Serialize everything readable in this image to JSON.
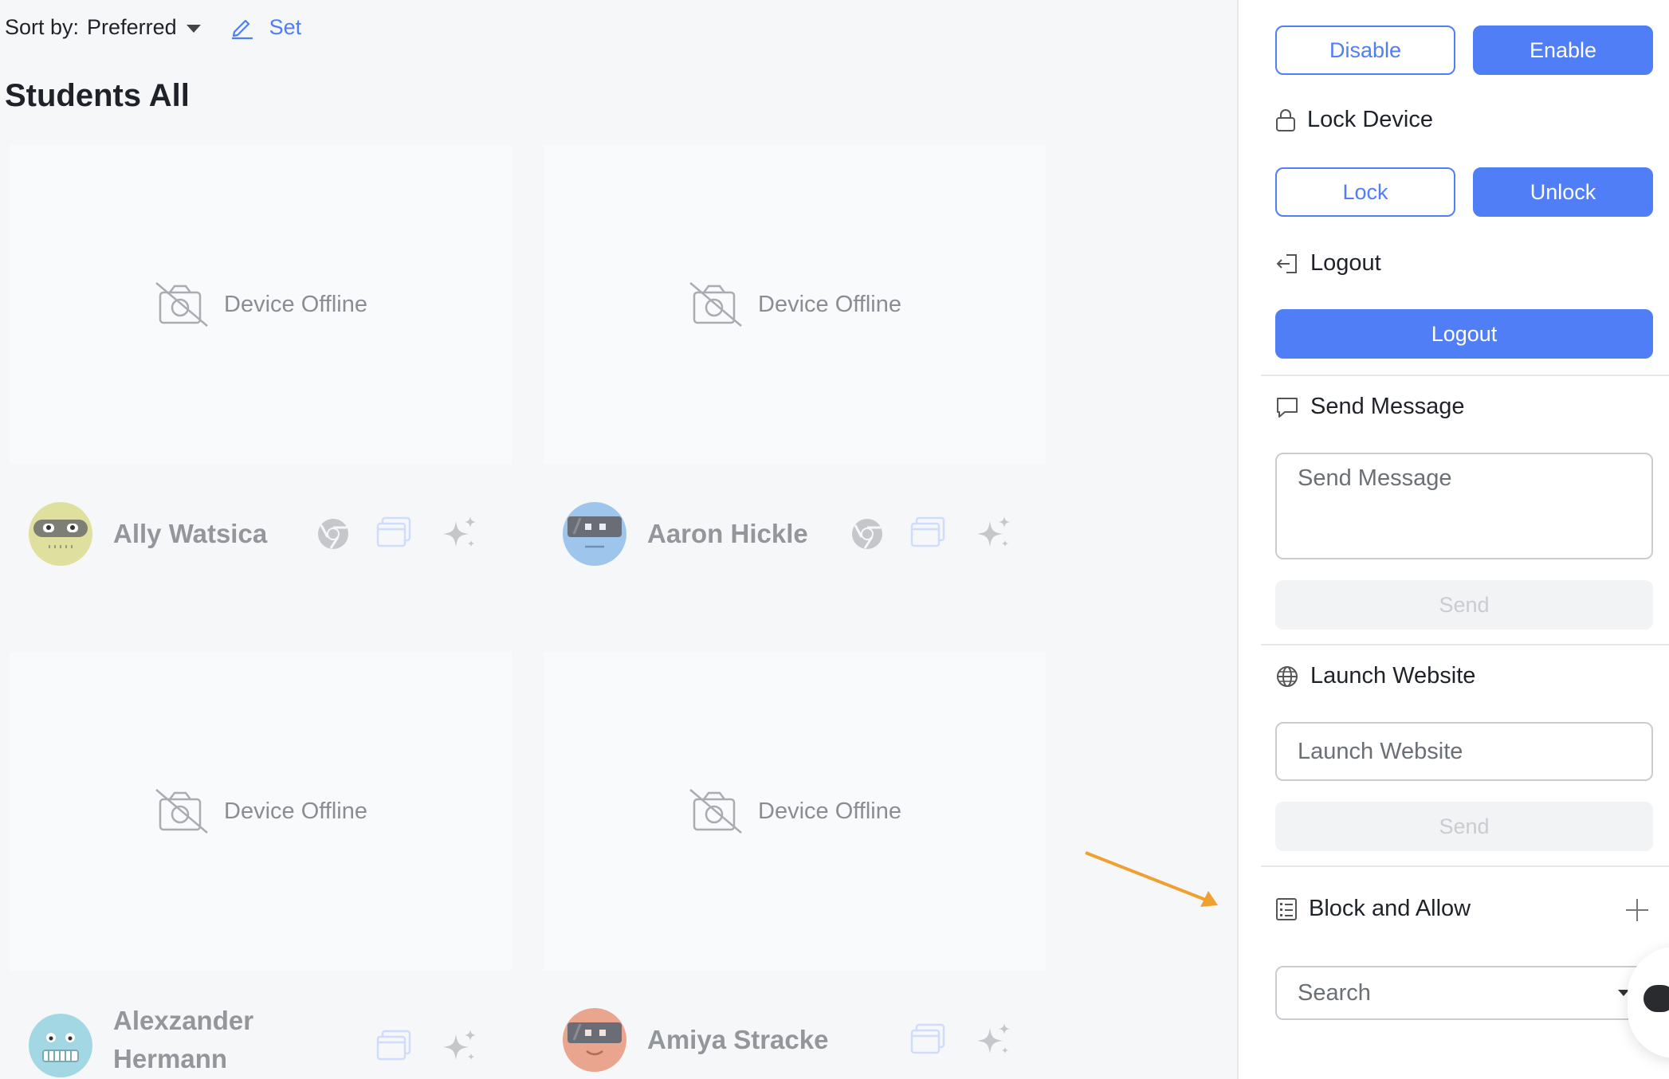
{
  "sort": {
    "label": "Sort by:",
    "value": "Preferred",
    "set_label": "Set"
  },
  "page_title": "Students All",
  "cards": [
    {
      "status": "Device Offline"
    },
    {
      "status": "Device Offline"
    },
    {
      "status": "Device Offline"
    },
    {
      "status": "Device Offline"
    }
  ],
  "students": [
    {
      "name": "Ally Watsica",
      "icons": [
        "chrome-icon",
        "window-icon",
        "sparkle-icon"
      ]
    },
    {
      "name": "Aaron Hickle",
      "icons": [
        "chrome-icon",
        "window-icon",
        "sparkle-icon"
      ]
    },
    {
      "name_line1": "Alexzander",
      "name_line2": "Hermann",
      "icons": [
        "window-icon",
        "sparkle-icon"
      ]
    },
    {
      "name": "Amiya Stracke",
      "icons": [
        "window-icon",
        "sparkle-icon"
      ]
    }
  ],
  "panel": {
    "disable_label": "Disable",
    "enable_label": "Enable",
    "lock_device_title": "Lock Device",
    "lock_label": "Lock",
    "unlock_label": "Unlock",
    "logout_title": "Logout",
    "logout_label": "Logout",
    "send_message_title": "Send Message",
    "send_message_placeholder": "Send Message",
    "send_label": "Send",
    "launch_website_title": "Launch Website",
    "launch_website_placeholder": "Launch Website",
    "launch_send_label": "Send",
    "block_allow_title": "Block and Allow",
    "search_placeholder": "Search"
  },
  "colors": {
    "accent": "#4f7ef6",
    "annotation_arrow": "#f0a030"
  }
}
